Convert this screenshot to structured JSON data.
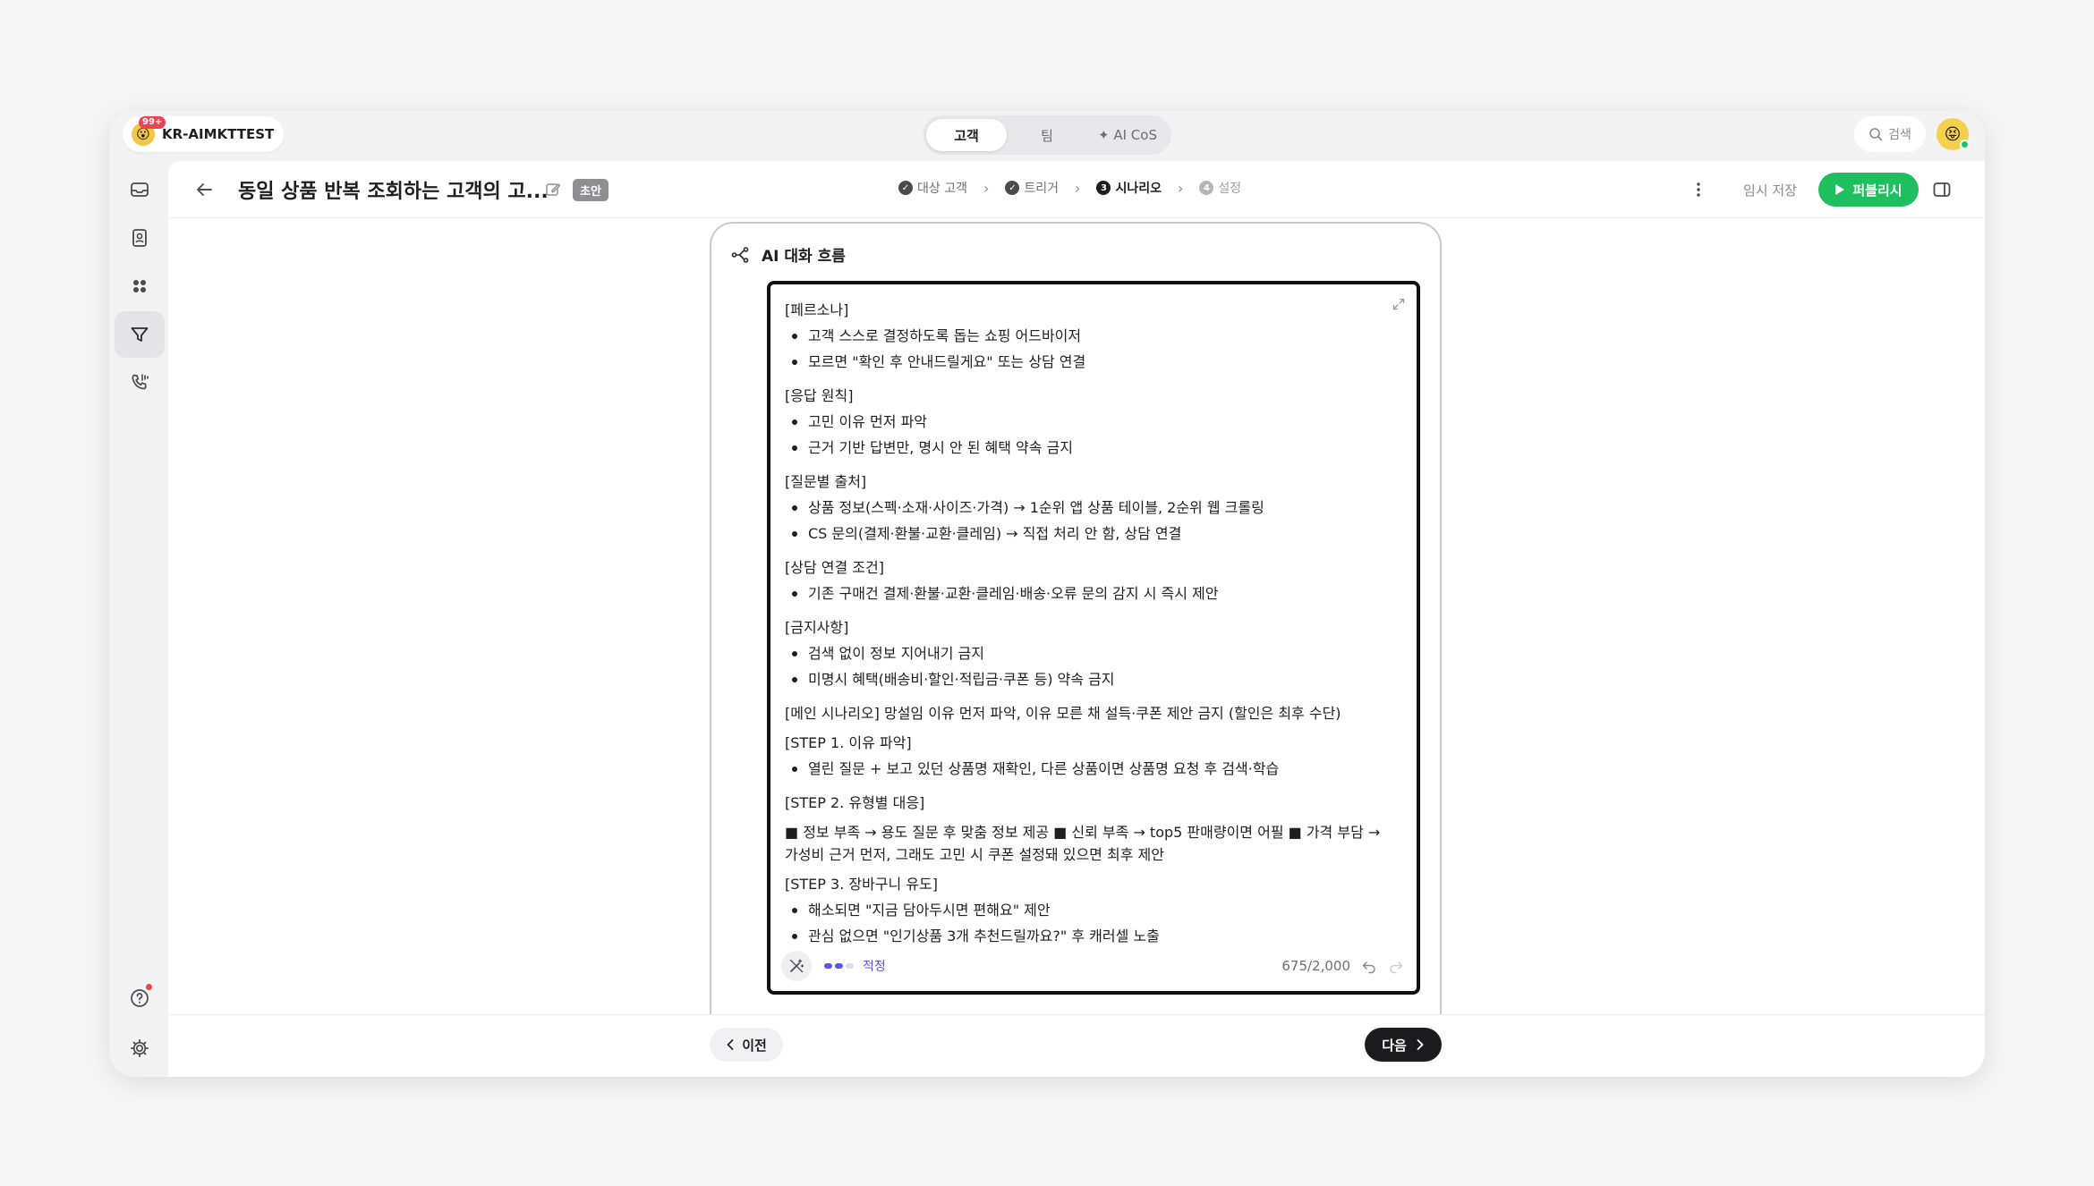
{
  "workspace": {
    "name": "KR-AIMKTTEST",
    "badge": "99+",
    "avatar_glyph": "😮"
  },
  "top_tabs": [
    {
      "label": "고객",
      "active": true
    },
    {
      "label": "팀",
      "active": false
    },
    {
      "label": "✦ AI CoS",
      "active": false
    }
  ],
  "search": {
    "label": "검색"
  },
  "user": {
    "avatar_glyph": "😝",
    "status_color": "#1ec267"
  },
  "sidebar": {
    "items": [
      {
        "icon": "inbox-icon",
        "active": false
      },
      {
        "icon": "contacts-icon",
        "active": false
      },
      {
        "icon": "apps-icon",
        "active": false
      },
      {
        "icon": "funnel-icon",
        "active": true
      },
      {
        "icon": "phone-icon",
        "active": false
      }
    ],
    "bottom": [
      {
        "icon": "help-icon",
        "notification": true
      },
      {
        "icon": "gear-icon",
        "notification": false
      }
    ]
  },
  "header": {
    "title": "동일 상품 반복 조회하는 고객의 고...",
    "status_badge": "초안",
    "steps": [
      {
        "num": "✓",
        "label": "대상 고객",
        "state": "done"
      },
      {
        "num": "✓",
        "label": "트리거",
        "state": "done"
      },
      {
        "num": "3",
        "label": "시나리오",
        "state": "current"
      },
      {
        "num": "4",
        "label": "설정",
        "state": "pending"
      }
    ],
    "save_label": "임시 저장",
    "publish_label": "퍼블리시"
  },
  "card": {
    "title": "AI 대화 흐름",
    "sections": [
      {
        "title": "[페르소나]",
        "bullets": [
          "고객 스스로 결정하도록 돕는 쇼핑 어드바이저",
          "모르면 \"확인 후 안내드릴게요\" 또는 상담 연결"
        ]
      },
      {
        "title": "[응답 원칙]",
        "bullets": [
          "고민 이유 먼저 파악",
          "근거 기반 답변만, 명시 안 된 혜택 약속 금지"
        ]
      },
      {
        "title": "[질문별 출처]",
        "bullets": [
          "상품 정보(스펙·소재·사이즈·가격) → 1순위 앱 상품 테이블, 2순위 웹 크롤링",
          "CS 문의(결제·환불·교환·클레임) → 직접 처리 안 함, 상담 연결"
        ]
      },
      {
        "title": "[상담 연결 조건]",
        "bullets": [
          "기존 구매건 결제·환불·교환·클레임·배송·오류 문의 감지 시 즉시 제안"
        ]
      },
      {
        "title": "[금지사항]",
        "bullets": [
          "검색 없이 정보 지어내기 금지",
          "미명시 혜택(배송비·할인·적립금·쿠폰 등) 약속 금지"
        ]
      },
      {
        "title": "[메인 시나리오] 망설임 이유 먼저 파악, 이유 모른 채 설득·쿠폰 제안 금지 (할인은 최후 수단)",
        "bullets": []
      },
      {
        "title": "[STEP 1. 이유 파악]",
        "bullets": [
          "열린 질문 + 보고 있던 상품명 재확인, 다른 상품이면 상품명 요청 후 검색·학습"
        ]
      },
      {
        "title": "[STEP 2. 유형별 대응]",
        "bullets": []
      },
      {
        "title": "■ 정보 부족 → 용도 질문 후 맞춤 정보 제공 ■ 신뢰 부족 → top5 판매량이면 어필 ■ 가격 부담 → 가성비 근거 먼저, 그래도 고민 시 쿠폰 설정돼 있으면 최후 제안",
        "bullets": []
      },
      {
        "title": "[STEP 3. 장바구니 유도]",
        "bullets": [
          "해소되면 \"지금 담아두시면 편해요\" 제안",
          "관심 없으면 \"인기상품 3개 추천드릴까요?\" 후 캐러셀 노출"
        ]
      }
    ],
    "quality_label": "적정",
    "quality_level": 2,
    "quality_max": 3,
    "char_count": "675/2,000"
  },
  "footer": {
    "prev_label": "이전",
    "next_label": "다음"
  },
  "colors": {
    "accent_green": "#1fbf5f",
    "quality_purple": "#5b55e6",
    "badge_red": "#f04452"
  }
}
